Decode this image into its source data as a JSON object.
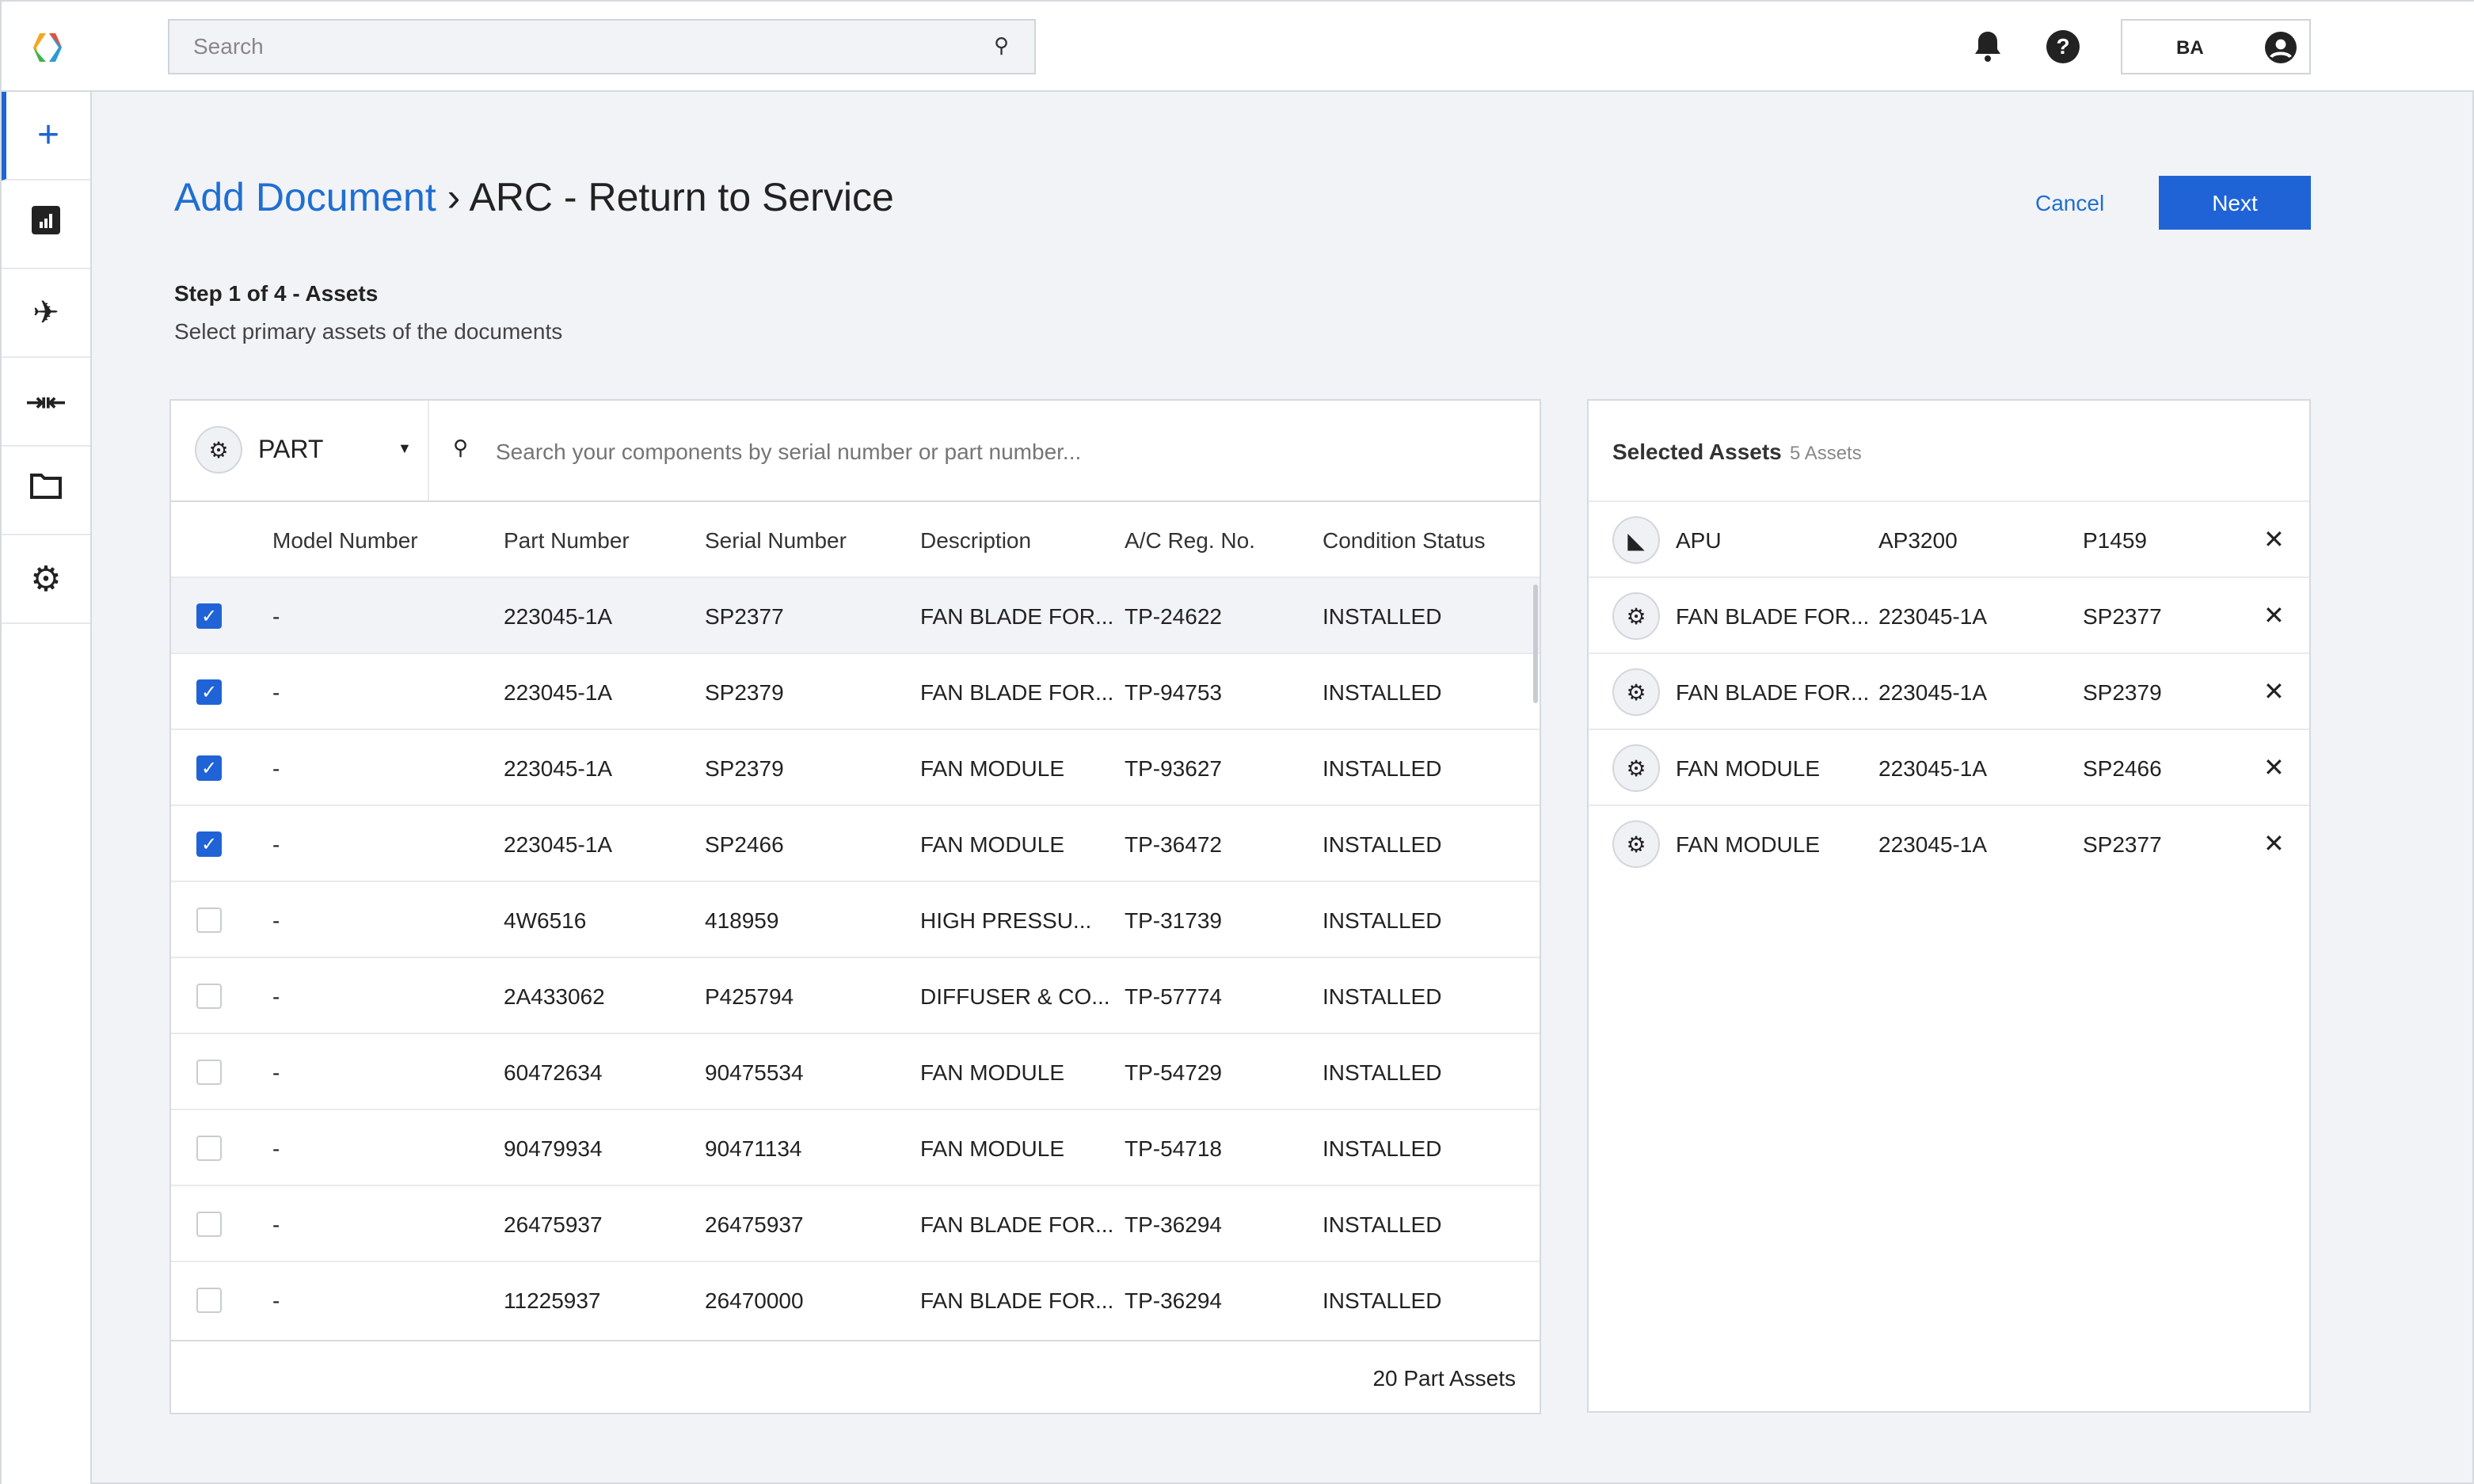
{
  "header": {
    "search_placeholder": "Search",
    "user_initials": "BA"
  },
  "sidebar": {
    "items": [
      "add",
      "analytics",
      "aircraft",
      "transfer",
      "folder",
      "settings"
    ]
  },
  "page": {
    "breadcrumb_link": "Add Document",
    "breadcrumb_sep": "›",
    "title": "ARC - Return to Service",
    "cancel_label": "Cancel",
    "next_label": "Next",
    "step": "Step 1 of 4 - Assets",
    "step_desc": "Select primary assets of the documents"
  },
  "colors": {
    "accent": "#1f63d6"
  },
  "assets": {
    "type_selector": "PART",
    "search_placeholder": "Search your components by serial number or part number...",
    "columns": [
      "Model Number",
      "Part Number",
      "Serial Number",
      "Description",
      "A/C Reg. No.",
      "Condition Status"
    ],
    "rows": [
      {
        "checked": true,
        "model": "-",
        "part": "223045-1A",
        "serial": "SP2377",
        "desc": "FAN BLADE FOR...",
        "reg": "TP-24622",
        "status": "INSTALLED"
      },
      {
        "checked": true,
        "model": "-",
        "part": "223045-1A",
        "serial": "SP2379",
        "desc": "FAN BLADE FOR...",
        "reg": "TP-94753",
        "status": "INSTALLED"
      },
      {
        "checked": true,
        "model": "-",
        "part": "223045-1A",
        "serial": "SP2379",
        "desc": "FAN MODULE",
        "reg": "TP-93627",
        "status": "INSTALLED"
      },
      {
        "checked": true,
        "model": "-",
        "part": "223045-1A",
        "serial": "SP2466",
        "desc": "FAN MODULE",
        "reg": "TP-36472",
        "status": "INSTALLED"
      },
      {
        "checked": false,
        "model": "-",
        "part": "4W6516",
        "serial": "418959",
        "desc": "HIGH PRESSU...",
        "reg": "TP-31739",
        "status": "INSTALLED"
      },
      {
        "checked": false,
        "model": "-",
        "part": "2A433062",
        "serial": "P425794",
        "desc": "DIFFUSER & CO...",
        "reg": "TP-57774",
        "status": "INSTALLED"
      },
      {
        "checked": false,
        "model": "-",
        "part": "60472634",
        "serial": "90475534",
        "desc": "FAN MODULE",
        "reg": "TP-54729",
        "status": "INSTALLED"
      },
      {
        "checked": false,
        "model": "-",
        "part": "90479934",
        "serial": "90471134",
        "desc": "FAN MODULE",
        "reg": "TP-54718",
        "status": "INSTALLED"
      },
      {
        "checked": false,
        "model": "-",
        "part": "26475937",
        "serial": "26475937",
        "desc": "FAN BLADE FOR...",
        "reg": "TP-36294",
        "status": "INSTALLED"
      },
      {
        "checked": false,
        "model": "-",
        "part": "11225937",
        "serial": "26470000",
        "desc": "FAN BLADE FOR...",
        "reg": "TP-36294",
        "status": "INSTALLED"
      }
    ],
    "footer": "20 Part Assets"
  },
  "selected": {
    "title": "Selected Assets",
    "count": "5 Assets",
    "items": [
      {
        "icon": "apu-icon",
        "name": "APU",
        "part": "AP3200",
        "serial": "P1459"
      },
      {
        "icon": "part-icon",
        "name": "FAN BLADE FOR...",
        "part": "223045-1A",
        "serial": "SP2377"
      },
      {
        "icon": "part-icon",
        "name": "FAN BLADE FOR...",
        "part": "223045-1A",
        "serial": "SP2379"
      },
      {
        "icon": "part-icon",
        "name": "FAN MODULE",
        "part": "223045-1A",
        "serial": "SP2466"
      },
      {
        "icon": "part-icon",
        "name": "FAN MODULE",
        "part": "223045-1A",
        "serial": "SP2377"
      }
    ]
  }
}
